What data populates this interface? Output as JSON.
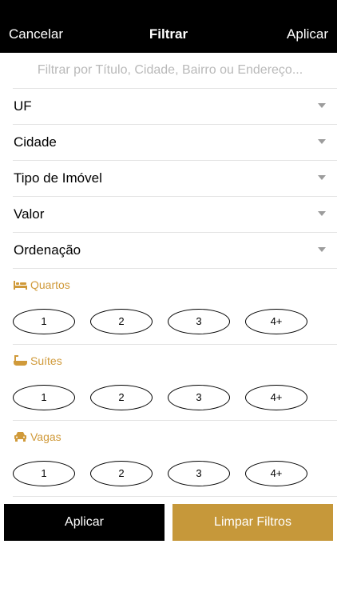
{
  "navbar": {
    "cancel_label": "Cancelar",
    "title": "Filtrar",
    "apply_label": "Aplicar"
  },
  "search": {
    "placeholder": "Filtrar por Título, Cidade, Bairro ou Endereço...",
    "value": ""
  },
  "dropdowns": [
    {
      "label": "UF",
      "icon": "chevron-down-icon"
    },
    {
      "label": "Cidade",
      "icon": "chevron-down-icon"
    },
    {
      "label": "Tipo de Imóvel",
      "icon": "chevron-down-icon"
    },
    {
      "label": "Valor",
      "icon": "chevron-down-icon"
    },
    {
      "label": "Ordenação",
      "icon": "chevron-down-icon"
    }
  ],
  "sections": [
    {
      "title": "Quartos",
      "icon": "bed-icon",
      "options": [
        "1",
        "2",
        "3",
        "4+"
      ]
    },
    {
      "title": "Suítes",
      "icon": "bathtub-icon",
      "options": [
        "1",
        "2",
        "3",
        "4+"
      ]
    },
    {
      "title": "Vagas",
      "icon": "car-icon",
      "options": [
        "1",
        "2",
        "3",
        "4+"
      ]
    }
  ],
  "footer": {
    "apply_label": "Aplicar",
    "clear_label": "Limpar Filtros"
  },
  "colors": {
    "navbar_bg": "#000000",
    "accent": "#d09a3a",
    "clear_button_bg": "#c6983a",
    "divider": "#e4e4e4"
  }
}
